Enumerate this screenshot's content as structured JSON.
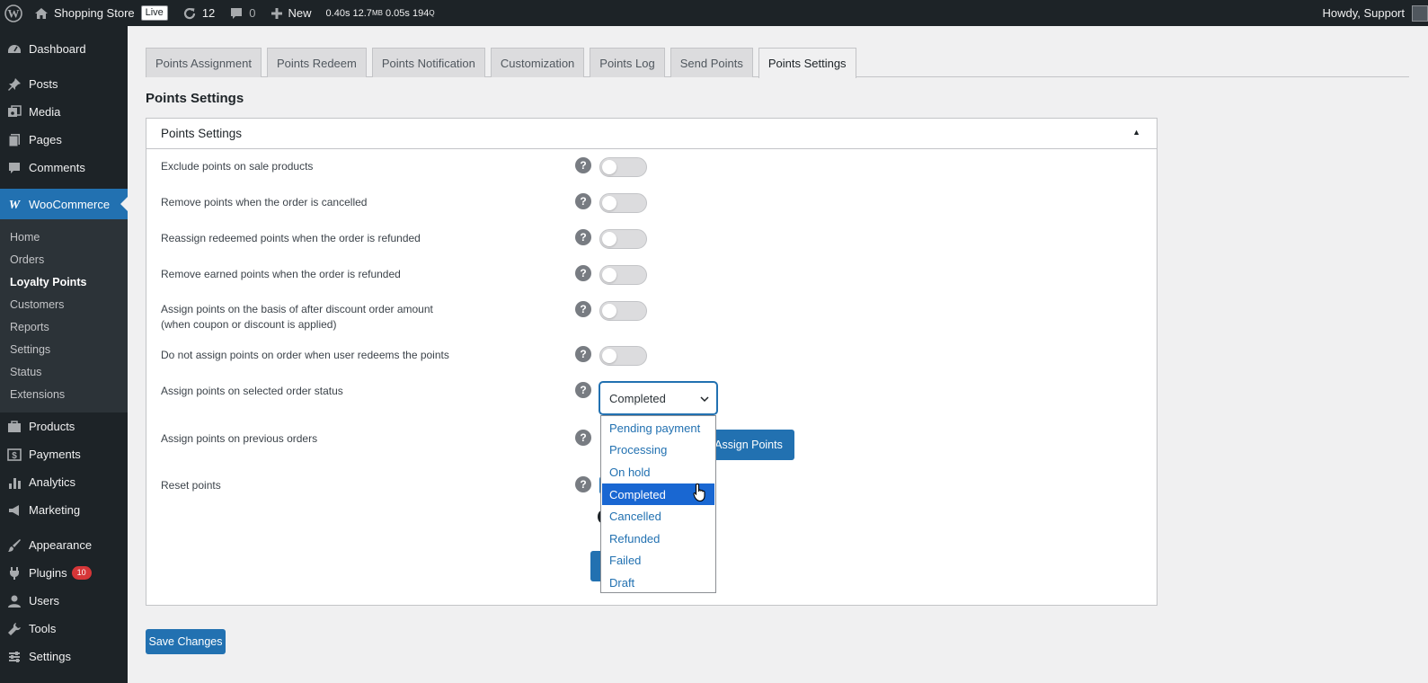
{
  "adminbar": {
    "site_name": "Shopping Store",
    "live_badge": "Live",
    "updates_count": "12",
    "comments_count": "0",
    "new_label": "New",
    "qm_time": "0.40s",
    "qm_mem": "12.7",
    "qm_mem_unit": "MB",
    "qm_db_time": "0.05s",
    "qm_queries": "194",
    "qm_queries_unit": "Q",
    "howdy": "Howdy, Support"
  },
  "sidebar": {
    "dashboard": "Dashboard",
    "posts": "Posts",
    "media": "Media",
    "pages": "Pages",
    "comments": "Comments",
    "woocommerce": "WooCommerce",
    "woo_sub": [
      "Home",
      "Orders",
      "Loyalty Points",
      "Customers",
      "Reports",
      "Settings",
      "Status",
      "Extensions"
    ],
    "products": "Products",
    "payments": "Payments",
    "analytics": "Analytics",
    "marketing": "Marketing",
    "appearance": "Appearance",
    "plugins": "Plugins",
    "plugins_badge": "10",
    "users": "Users",
    "tools": "Tools",
    "settings": "Settings"
  },
  "tabs": [
    "Points Assignment",
    "Points Redeem",
    "Points Notification",
    "Customization",
    "Points Log",
    "Send Points",
    "Points Settings"
  ],
  "page_title": "Points Settings",
  "panel": {
    "title": "Points Settings",
    "rows": {
      "exclude_sale": "Exclude points on sale products",
      "remove_cancelled": "Remove points when the order is cancelled",
      "reassign_refunded": "Reassign redeemed points when the order is refunded",
      "remove_earned_refunded": "Remove earned points when the order is refunded",
      "after_discount_line1": "Assign points on the basis of after discount order amount",
      "after_discount_line2": "(when coupon or discount is applied)",
      "no_assign_redeem": "Do not assign points on order when user redeems the points",
      "order_status": "Assign points on selected order status",
      "previous_orders": "Assign points on previous orders",
      "reset_points": "Reset points"
    },
    "help_glyph": "?",
    "order_status_value": "Completed",
    "order_status_options": [
      "Pending payment",
      "Processing",
      "On hold",
      "Completed",
      "Cancelled",
      "Refunded",
      "Failed",
      "Draft"
    ],
    "assign_points_button": "Assign Points"
  },
  "save_button": "Save Changes"
}
